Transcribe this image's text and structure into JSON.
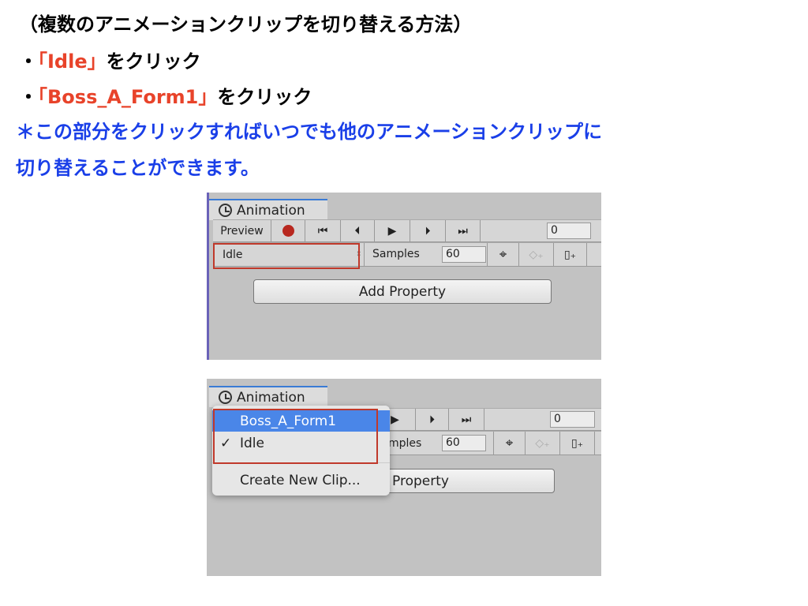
{
  "slide": {
    "title": "（複数のアニメーションクリップを切り替える方法）",
    "bullet1": {
      "bullet": "・",
      "highlight": "「Idle」",
      "text": "をクリック"
    },
    "bullet2": {
      "bullet": "・",
      "highlight": "「Boss_A_Form1」",
      "text": "をクリック"
    },
    "note1": "＊この部分をクリックすればいつでも他のアニメーションクリップに",
    "note2": "切り替えることができます。"
  },
  "colors": {
    "highlight": "#e8432a",
    "note": "#1a3fe8",
    "menu_selected": "#4a86e8",
    "annotation_box": "#c0392b"
  },
  "panel": {
    "tab_label": "Animation",
    "preview_label": "Preview",
    "frame_value": "0",
    "clip_value": "Idle",
    "samples_label": "Samples",
    "samples_value": "60",
    "add_property_label": "Add Property",
    "add_property_partial": "Property",
    "samples_partial": "mples",
    "icons": [
      "clock-icon",
      "record-icon",
      "first-key-icon",
      "prev-key-icon",
      "play-icon",
      "next-key-icon",
      "last-key-icon",
      "add-keyframe-icon",
      "add-event-icon"
    ]
  },
  "menu": {
    "items": [
      {
        "label": "Boss_A_Form1",
        "selected": true,
        "checked": false
      },
      {
        "label": "Idle",
        "checked": true,
        "selected": false
      },
      {
        "label": "Create New Clip..."
      }
    ],
    "check": "✓"
  }
}
